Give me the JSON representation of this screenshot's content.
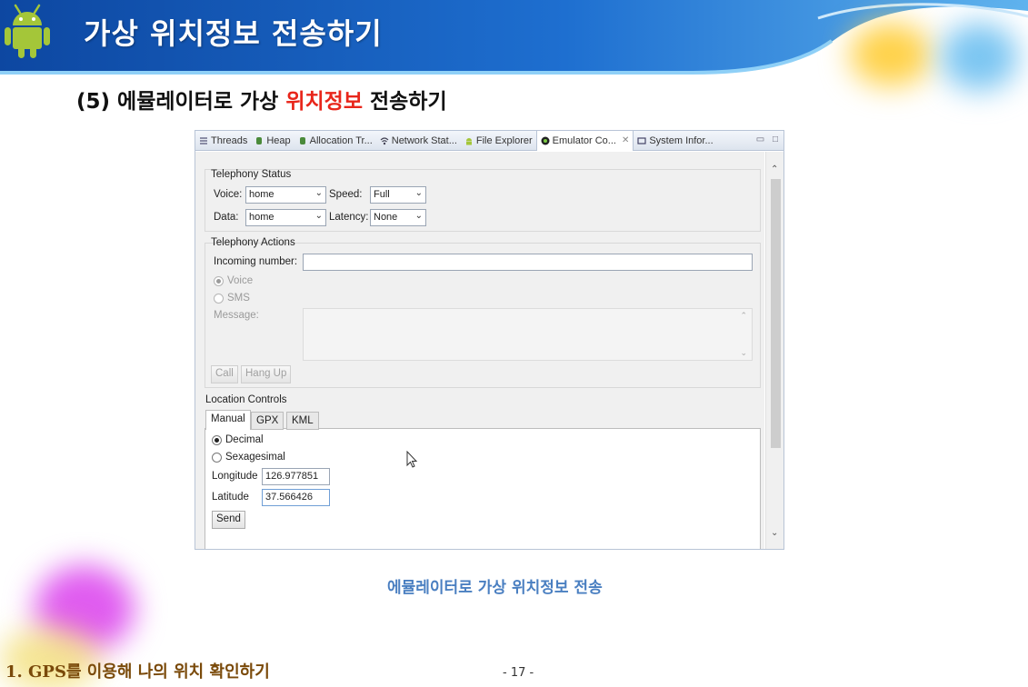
{
  "slide": {
    "title": "가상 위치정보 전송하기",
    "subtitle_prefix": "(5) 에뮬레이터로 가상 ",
    "subtitle_highlight": "위치정보",
    "subtitle_suffix": " 전송하기",
    "caption": "에뮬레이터로 가상 위치정보 전송",
    "footer": "1. GPS를 이용해 나의 위치 확인하기",
    "page_number": "- 17 -"
  },
  "colors": {
    "header_blue": "#1565c0",
    "highlight_red": "#e8261b",
    "caption_blue": "#4a7fc1",
    "footer_brown": "#7a4a0a"
  },
  "view_tabs": [
    {
      "label": "Threads",
      "icon": "threads-icon"
    },
    {
      "label": "Heap",
      "icon": "heap-icon"
    },
    {
      "label": "Allocation Tr...",
      "icon": "allocation-icon"
    },
    {
      "label": "Network Stat...",
      "icon": "network-icon"
    },
    {
      "label": "File Explorer",
      "icon": "android-icon"
    },
    {
      "label": "Emulator Co...",
      "icon": "emulator-icon",
      "active": true
    },
    {
      "label": "System Infor...",
      "icon": "system-icon"
    }
  ],
  "telephony_status": {
    "title": "Telephony Status",
    "voice_label": "Voice:",
    "voice_value": "home",
    "speed_label": "Speed:",
    "speed_value": "Full",
    "data_label": "Data:",
    "data_value": "home",
    "latency_label": "Latency:",
    "latency_value": "None"
  },
  "telephony_actions": {
    "title": "Telephony Actions",
    "incoming_label": "Incoming number:",
    "incoming_value": "",
    "voice_option": "Voice",
    "sms_option": "SMS",
    "message_label": "Message:",
    "call_button": "Call",
    "hangup_button": "Hang Up"
  },
  "location_controls": {
    "title": "Location Controls",
    "tabs": [
      "Manual",
      "GPX",
      "KML"
    ],
    "decimal_option": "Decimal",
    "sexagesimal_option": "Sexagesimal",
    "longitude_label": "Longitude",
    "longitude_value": "126.977851",
    "latitude_label": "Latitude",
    "latitude_value": "37.566426",
    "send_button": "Send"
  }
}
